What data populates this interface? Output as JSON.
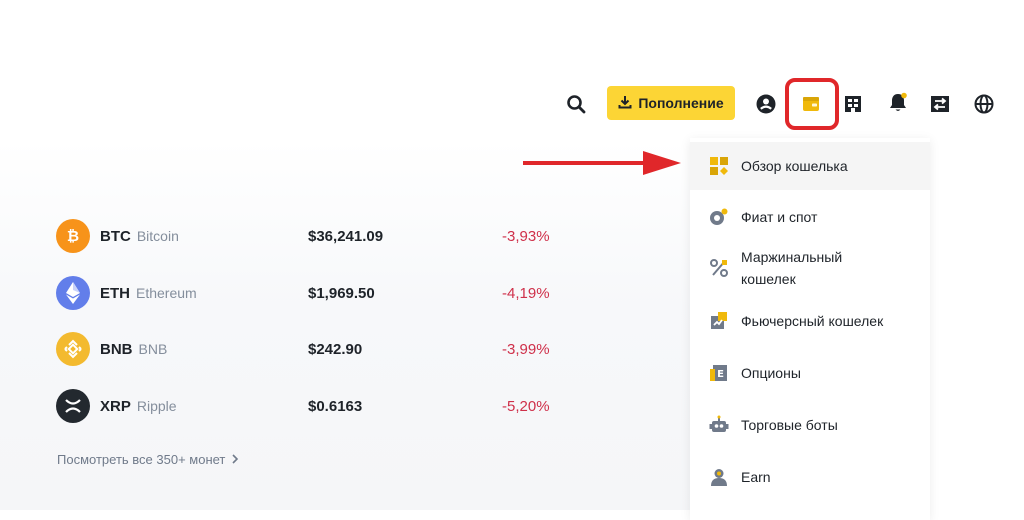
{
  "header": {
    "deposit_label": "Пополнение",
    "icons": [
      "search-icon",
      "download-icon",
      "user-profile-icon",
      "wallet-icon",
      "orders-icon",
      "notifications-bell-icon",
      "transfer-icon",
      "globe-language-icon"
    ],
    "highlight_color": "#e0272a",
    "accent_color": "#fcd535"
  },
  "coins": [
    {
      "symbol": "BTC",
      "name": "Bitcoin",
      "price": "$36,241.09",
      "change": "-3,93%",
      "logo_color": "#f7931a"
    },
    {
      "symbol": "ETH",
      "name": "Ethereum",
      "price": "$1,969.50",
      "change": "-4,19%",
      "logo_color": "#627eea"
    },
    {
      "symbol": "BNB",
      "name": "BNB",
      "price": "$242.90",
      "change": "-3,99%",
      "logo_color": "#f3ba2f"
    },
    {
      "symbol": "XRP",
      "name": "Ripple",
      "price": "$0.6163",
      "change": "-5,20%",
      "logo_color": "#23292f"
    }
  ],
  "change_color": "#cf304a",
  "see_all": "Посмотреть все 350+ монет",
  "wallet_menu": {
    "items": [
      {
        "label": "Обзор кошелька",
        "icon": "wallet-overview-icon",
        "active": true
      },
      {
        "label": "Фиат и спот",
        "icon": "fiat-spot-icon"
      },
      {
        "label_line1": "Маржинальный",
        "label_line2": "кошелек",
        "icon": "margin-percent-icon"
      },
      {
        "label": "Фьючерсный кошелек",
        "icon": "futures-icon"
      },
      {
        "label": "Опционы",
        "icon": "options-icon"
      },
      {
        "label": "Торговые боты",
        "icon": "trading-bot-icon"
      },
      {
        "label": "Earn",
        "icon": "earn-icon"
      }
    ]
  }
}
